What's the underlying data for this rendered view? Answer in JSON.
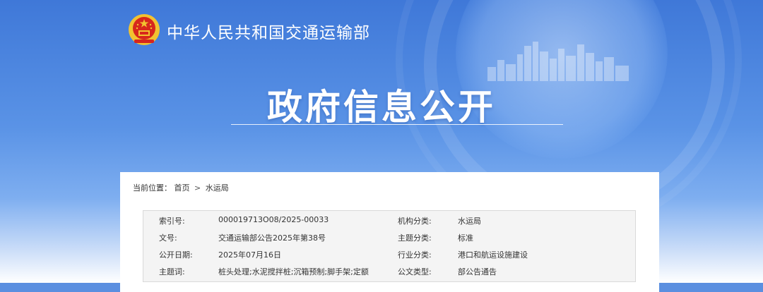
{
  "header": {
    "ministry_name": "中华人民共和国交通运输部",
    "page_title": "政府信息公开"
  },
  "breadcrumb": {
    "prefix": "当前位置：",
    "items": [
      {
        "label": "首页"
      },
      {
        "label": "水运局"
      }
    ],
    "separator": ">"
  },
  "info": {
    "rows": [
      {
        "label1": "索引号:",
        "value1": "000019713O08/2025-00033",
        "label2": "机构分类:",
        "value2": "水运局"
      },
      {
        "label1": "文号:",
        "value1": "交通运输部公告2025年第38号",
        "label2": "主题分类:",
        "value2": "标准"
      },
      {
        "label1": "公开日期:",
        "value1": "2025年07月16日",
        "label2": "行业分类:",
        "value2": "港口和航运设施建设"
      },
      {
        "label1": "主题词:",
        "value1": "桩头处理;水泥搅拌桩;沉箱预制;脚手架;定额",
        "label2": "公文类型:",
        "value2": "部公告通告"
      }
    ]
  },
  "colors": {
    "header_blue": "#3f78d8",
    "emblem_red": "#d7261c",
    "emblem_gold": "#f2c230"
  }
}
